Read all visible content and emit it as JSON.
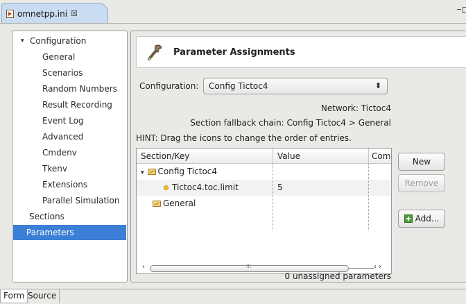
{
  "editor_tab": {
    "label": "omnetpp.ini",
    "close_glyph": "☒"
  },
  "tree": {
    "items": [
      {
        "label": "Configuration",
        "level": 0,
        "expanded": true
      },
      {
        "label": "General",
        "level": 1
      },
      {
        "label": "Scenarios",
        "level": 1
      },
      {
        "label": "Random Numbers",
        "level": 1
      },
      {
        "label": "Result Recording",
        "level": 1
      },
      {
        "label": "Event Log",
        "level": 1
      },
      {
        "label": "Advanced",
        "level": 1
      },
      {
        "label": "Cmdenv",
        "level": 1
      },
      {
        "label": "Tkenv",
        "level": 1
      },
      {
        "label": "Extensions",
        "level": 1
      },
      {
        "label": "Parallel Simulation",
        "level": 1
      },
      {
        "label": "Sections",
        "level": 0
      },
      {
        "label": "Parameters",
        "level": 0,
        "selected": true
      }
    ]
  },
  "header": {
    "title": "Parameter Assignments",
    "icon": "wrench-icon"
  },
  "configuration": {
    "label": "Configuration:",
    "selected": "Config Tictoc4"
  },
  "network_line": "Network: Tictoc4",
  "fallback_line": "Section fallback chain: Config Tictoc4 > General",
  "hint": "HINT: Drag the icons to change the order of entries.",
  "table": {
    "columns": [
      "Section/Key",
      "Value",
      "Com"
    ],
    "rows": [
      {
        "key": "Config Tictoc4",
        "value": "",
        "type": "section",
        "expanded": true
      },
      {
        "key": "Tictoc4.toc.limit",
        "value": "5",
        "type": "param"
      },
      {
        "key": "General",
        "value": "",
        "type": "section"
      }
    ]
  },
  "buttons": {
    "new": "New",
    "remove": "Remove",
    "add": "Add..."
  },
  "unassigned": "0 unassigned parameters",
  "bottom_tabs": [
    "Form",
    "Source"
  ],
  "colors": {
    "selection": "#3b7fd6",
    "tab_active": "#c9dcf1"
  }
}
